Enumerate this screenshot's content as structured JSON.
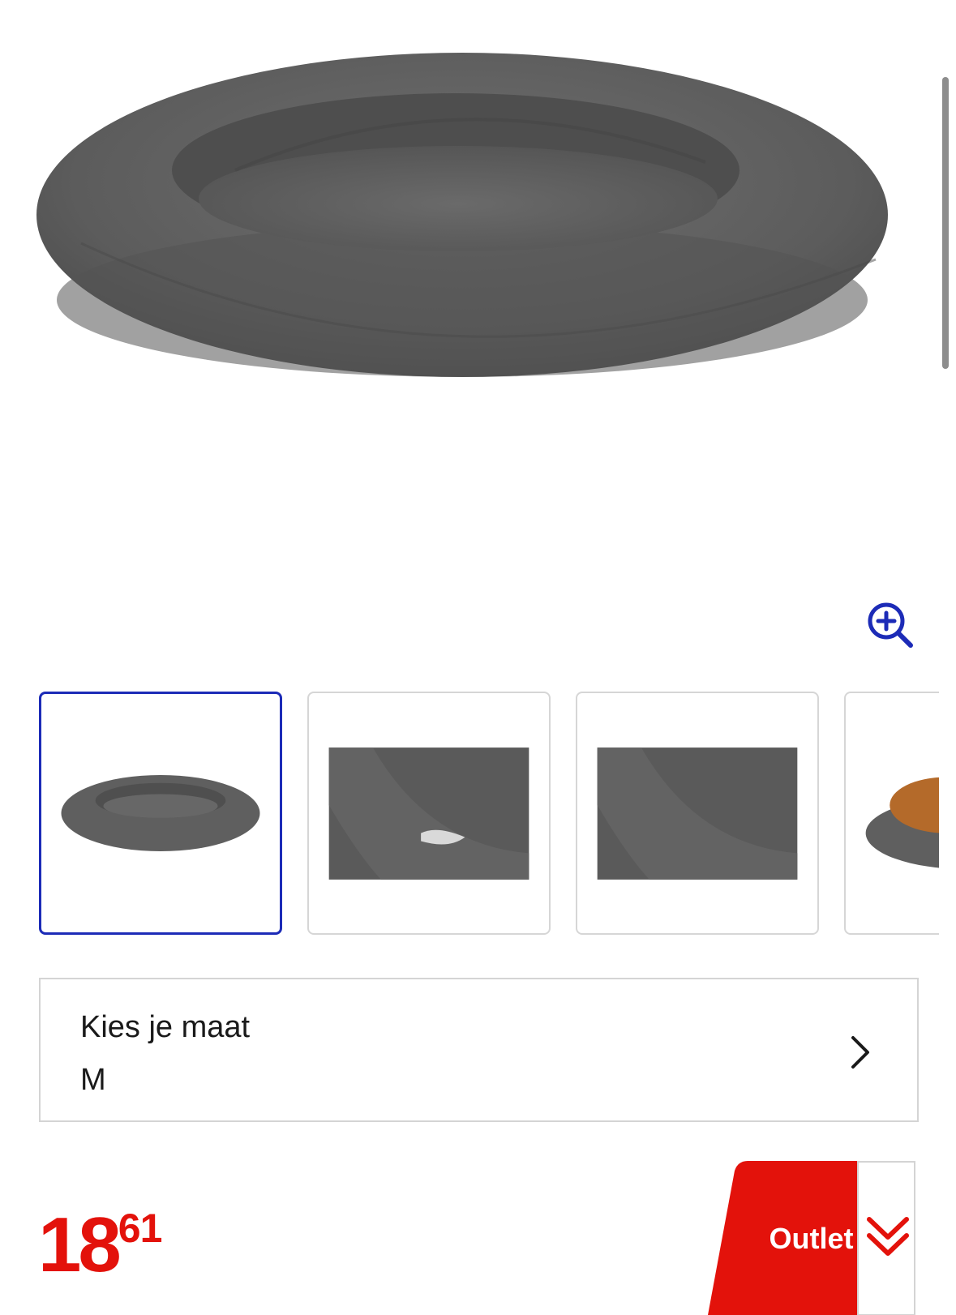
{
  "gallery": {
    "main_image_alt": "",
    "thumbnails": [
      {
        "name": "thumbnail-1",
        "selected": true
      },
      {
        "name": "thumbnail-2",
        "selected": false
      },
      {
        "name": "thumbnail-3",
        "selected": false
      },
      {
        "name": "thumbnail-4",
        "selected": false
      }
    ],
    "zoom_icon": "zoom-in-icon"
  },
  "size_selector": {
    "label": "Kies je maat",
    "value": "M",
    "chevron_icon": "chevron-right-icon"
  },
  "price": {
    "integer": "18",
    "decimal": "61",
    "color": "#e3120b"
  },
  "badge": {
    "label": "Outlet",
    "color": "#e3120b",
    "toggle_icon": "double-chevron-down-icon"
  },
  "colors": {
    "accent": "#1c2bb7",
    "brand_red": "#e3120b",
    "text": "#1a1a1a",
    "border": "#d4d4d4"
  }
}
